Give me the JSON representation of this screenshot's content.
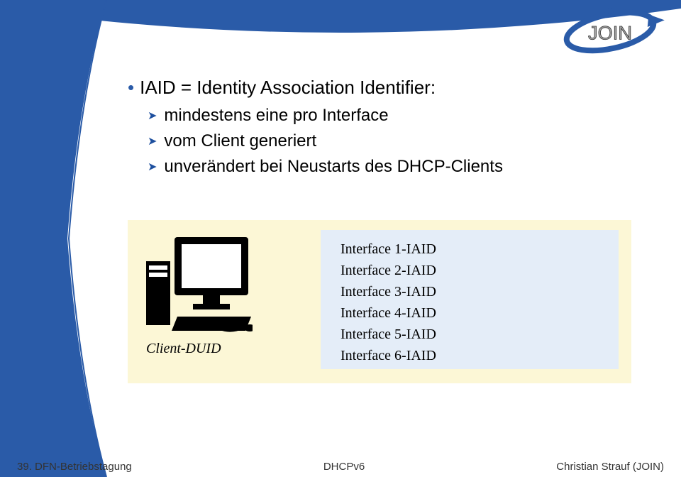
{
  "bullets": {
    "b1": "IAID = Identity Association Identifier:",
    "b2a": "mindestens eine pro Interface",
    "b2b": "vom Client generiert",
    "b2c": "unverändert bei Neustarts des DHCP-Clients"
  },
  "diagram": {
    "client_label": "Client-DUID",
    "interfaces": [
      "Interface 1-IAID",
      "Interface 2-IAID",
      "Interface 3-IAID",
      "Interface 4-IAID",
      "Interface 5-IAID",
      "Interface 6-IAID"
    ]
  },
  "footer": {
    "left": "39. DFN-Betriebstagung",
    "center": "DHCPv6",
    "right": "Christian Strauf (JOIN)"
  },
  "logo_text": "JOIN",
  "colors": {
    "brand_blue": "#2A5BA8"
  }
}
